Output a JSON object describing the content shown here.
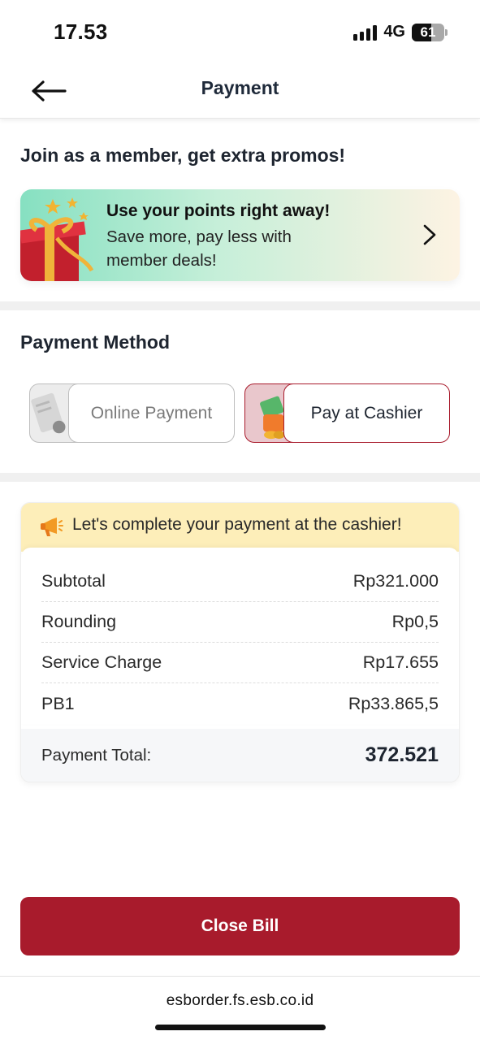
{
  "status_bar": {
    "time": "17.53",
    "network": "4G",
    "battery": "61",
    "battery_fraction": 0.61
  },
  "header": {
    "title": "Payment",
    "back_icon": "arrow-left-icon"
  },
  "member": {
    "heading": "Join as a member, get extra promos!",
    "banner_title": "Use your points right away!",
    "banner_subtitle": "Save more, pay less with member deals!",
    "banner_icon": "gift-icon",
    "chevron_icon": "chevron-right-icon"
  },
  "payment_method": {
    "heading": "Payment Method",
    "options": [
      {
        "label": "Online Payment",
        "selected": false,
        "icon": "receipt-icon"
      },
      {
        "label": "Pay at Cashier",
        "selected": true,
        "icon": "cash-icon"
      }
    ]
  },
  "notice": {
    "text": "Let's complete your payment at the cashier!",
    "icon": "megaphone-icon"
  },
  "summary": {
    "lines": [
      {
        "label": "Subtotal",
        "value": "Rp321.000"
      },
      {
        "label": "Rounding",
        "value": "Rp0,5"
      },
      {
        "label": "Service Charge",
        "value": "Rp17.655"
      },
      {
        "label": "PB1",
        "value": "Rp33.865,5"
      }
    ],
    "total_label": "Payment Total:",
    "total_value": "372.521"
  },
  "close_button": {
    "label": "Close Bill"
  },
  "browser": {
    "url": "esborder.fs.esb.co.id"
  },
  "colors": {
    "brand": "#a81b2c",
    "notice_bg": "#fdeeb9",
    "banner_start": "#86e0c1",
    "banner_end": "#fdf3e3"
  }
}
